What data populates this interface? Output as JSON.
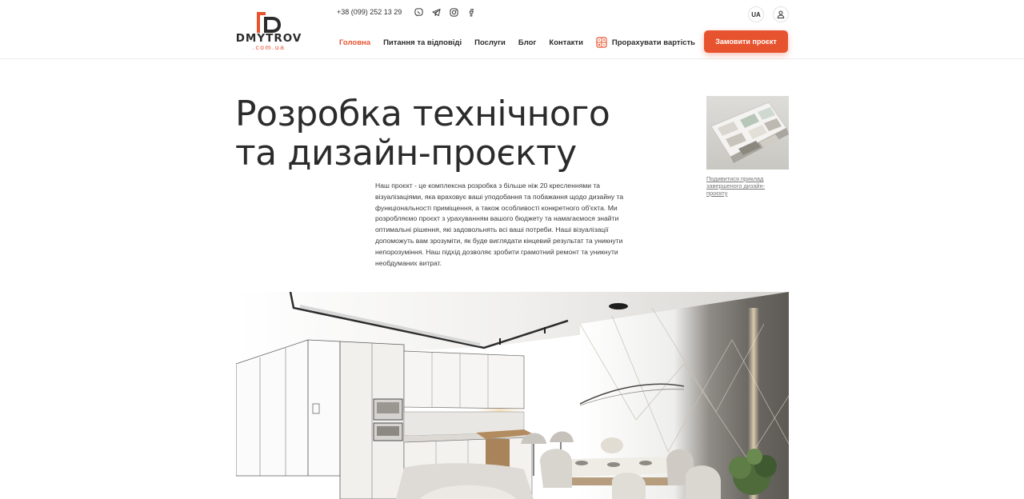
{
  "header": {
    "logo": {
      "name": "DMYTROV",
      "sub": ".com.ua"
    },
    "phone": "+38 (099) 252 13 29",
    "social_icons": [
      "viber-icon",
      "telegram-icon",
      "instagram-icon",
      "facebook-icon"
    ],
    "nav": [
      {
        "label": "Головна",
        "active": true
      },
      {
        "label": "Питання та відповіді",
        "active": false
      },
      {
        "label": "Послуги",
        "active": false
      },
      {
        "label": "Блог",
        "active": false
      },
      {
        "label": "Контакти",
        "active": false
      }
    ],
    "calc_label": "Прорахувати вартість",
    "lang": "UA",
    "cta_label": "Замовити проєкт"
  },
  "hero": {
    "title_line1": "Розробка технічного",
    "title_line2": "та дизайн-проєкту",
    "description": "Наш проєкт - це комплексна розробка з більше ніж 20 кресленнями та візуалізаціями, яка враховує ваші уподобання та побажання щодо дизайну та функціональності приміщення, а також особливості конкретного об'єкта. Ми розробляємо проєкт з урахуванням вашого бюджету та намагаємося знайти оптимальні рішення, які задовольнять всі ваші потреби. Наші візуалізації допоможуть вам зрозуміти, як буде виглядати кінцевий результат та уникнути непорозуміння. Наш підхід дозволяє зробити грамотний ремонт та уникнути необдуманих витрат.",
    "example_link": "Подивитися приклад завершеного дизайн-проєкту"
  },
  "colors": {
    "accent": "#e8532f",
    "text": "#2b2b2b"
  }
}
